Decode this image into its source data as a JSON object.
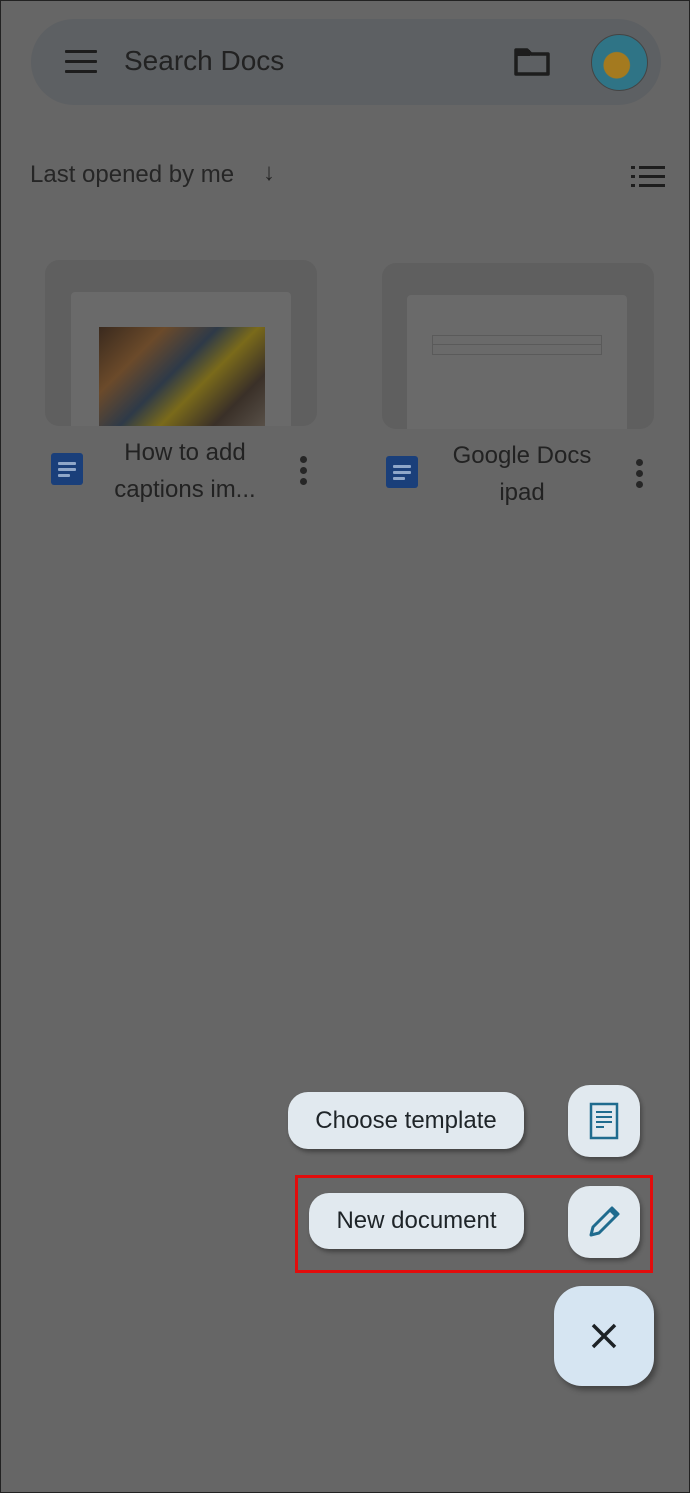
{
  "header": {
    "search_placeholder": "Search Docs",
    "menu_icon": "hamburger-menu-icon",
    "folder_icon": "folder-icon",
    "avatar": "account-avatar"
  },
  "sort": {
    "label": "Last opened by me",
    "direction_icon": "arrow-down-icon",
    "view_icon": "list-view-icon"
  },
  "documents": [
    {
      "title_line1": "How to add",
      "title_line2": "captions im...",
      "type_icon": "google-docs-icon",
      "thumbnail": "image-preview"
    },
    {
      "title_line1": "Google Docs",
      "title_line2": "ipad",
      "type_icon": "google-docs-icon",
      "thumbnail": "blank-preview"
    }
  ],
  "fab_menu": {
    "choose_template_label": "Choose template",
    "new_document_label": "New document",
    "template_icon": "document-template-icon",
    "new_icon": "pencil-icon",
    "close_icon": "close-icon"
  },
  "annotation": {
    "highlight_color": "#e20c0c",
    "highlighted": "New document"
  }
}
